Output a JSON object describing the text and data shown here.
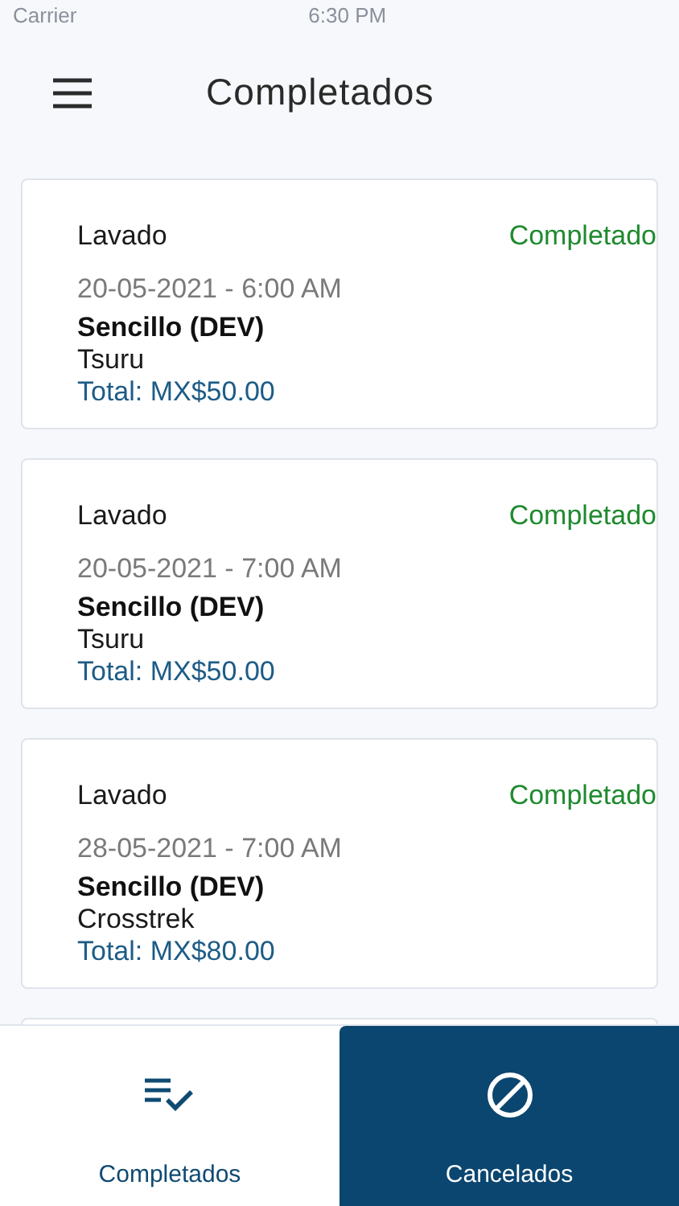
{
  "status_bar": {
    "carrier": "Carrier",
    "time": "6:30 PM"
  },
  "header": {
    "title": "Completados"
  },
  "orders": [
    {
      "service": "Lavado",
      "status": "Completado",
      "datetime": "20-05-2021 - 6:00 AM",
      "package": "Sencillo (DEV)",
      "vehicle": "Tsuru",
      "total": "Total: MX$50.00"
    },
    {
      "service": "Lavado",
      "status": "Completado",
      "datetime": "20-05-2021 - 7:00 AM",
      "package": "Sencillo (DEV)",
      "vehicle": "Tsuru",
      "total": "Total: MX$50.00"
    },
    {
      "service": "Lavado",
      "status": "Completado",
      "datetime": "28-05-2021 - 7:00 AM",
      "package": "Sencillo (DEV)",
      "vehicle": "Crosstrek",
      "total": "Total: MX$80.00"
    }
  ],
  "tabs": [
    {
      "kind": "completed",
      "label": "Completados",
      "selected": true
    },
    {
      "kind": "cancelled",
      "label": "Cancelados",
      "selected": false
    }
  ]
}
